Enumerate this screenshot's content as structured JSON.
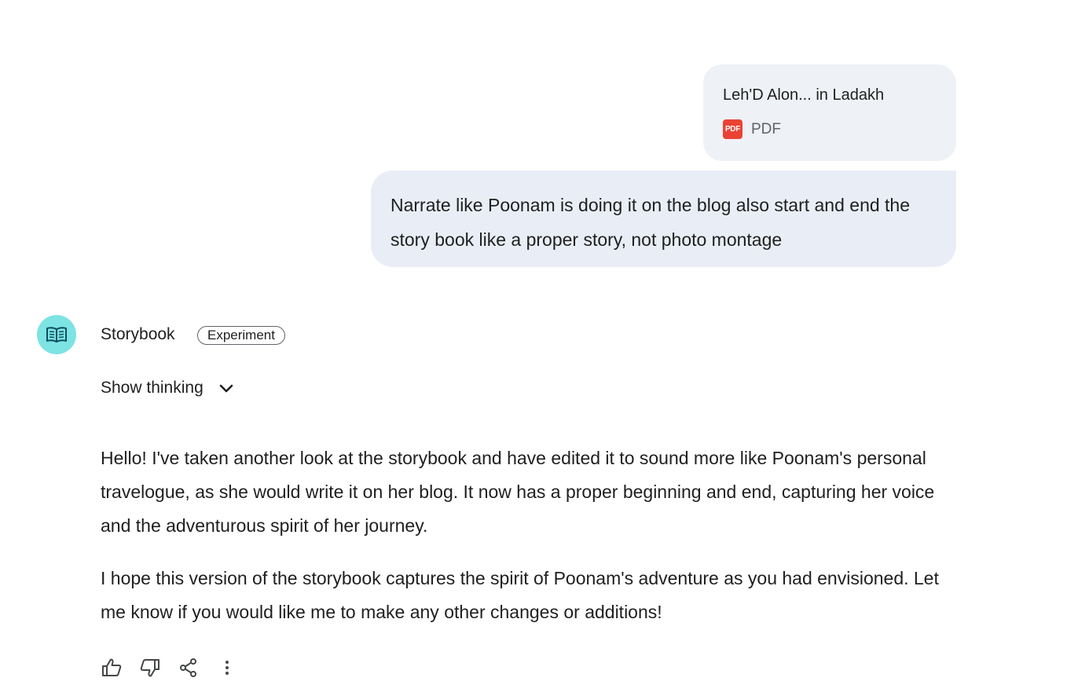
{
  "attachment": {
    "title": "Leh'D Alon... in Ladakh",
    "type_label": "PDF",
    "icon_text": "PDF",
    "icon": "pdf-icon"
  },
  "user_message": {
    "text": "Narrate like Poonam is doing it on the blog also start and end the story book like a proper story, not photo montage"
  },
  "bot": {
    "name": "Storybook",
    "badge": "Experiment",
    "avatar_icon": "book-icon",
    "avatar_color": "#7ee3e3",
    "show_thinking_label": "Show thinking",
    "paragraphs": [
      "Hello! I've taken another look at the storybook and have edited it to sound more like Poonam's personal travelogue, as she would write it on her blog. It now has a proper beginning and end, capturing her voice and the adventurous spirit of her journey.",
      "I hope this version of the storybook captures the spirit of Poonam's adventure as you had envisioned. Let me know if you would like me to make any other changes or additions!"
    ]
  },
  "actions": [
    "thumbs-up-icon",
    "thumbs-down-icon",
    "share-icon",
    "more-vert-icon"
  ],
  "colors": {
    "user_bubble": "#e9eef6",
    "attachment_card": "#eef1f6",
    "pdf_red": "#ea4335"
  }
}
